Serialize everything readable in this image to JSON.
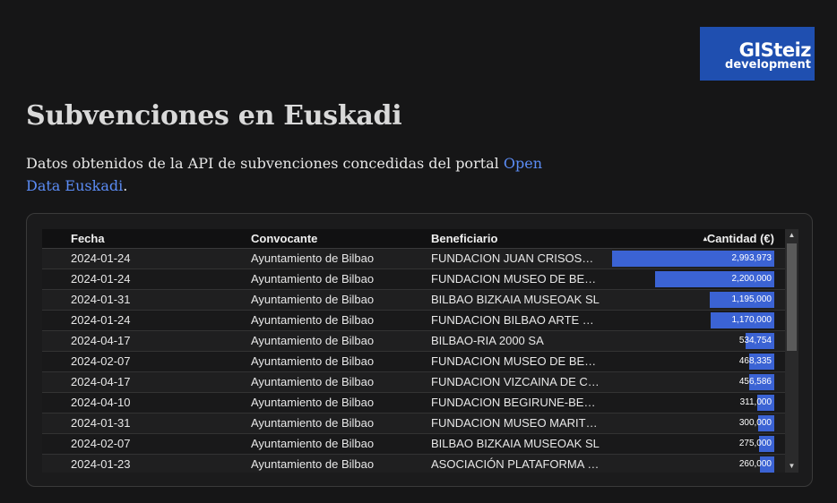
{
  "logo": {
    "line1": "GISteiz",
    "line2": "development"
  },
  "title": "Subvenciones en Euskadi",
  "description": {
    "text": "Datos obtenidos de la API de subvenciones concedidas del portal ",
    "link": "Open Data Euskadi",
    "end": "."
  },
  "table": {
    "columns": {
      "fecha": "Fecha",
      "convocante": "Convocante",
      "beneficiario": "Beneficiario",
      "cantidad": "Cantidad (€)"
    },
    "max_amount": 2993973,
    "rows": [
      {
        "fecha": "2024-01-24",
        "convocante": "Ayuntamiento de Bilbao",
        "beneficiario": "FUNDACION JUAN CRISOS…",
        "cantidad": "2,993,973",
        "amount": 2993973
      },
      {
        "fecha": "2024-01-24",
        "convocante": "Ayuntamiento de Bilbao",
        "beneficiario": "FUNDACION MUSEO DE BE…",
        "cantidad": "2,200,000",
        "amount": 2200000
      },
      {
        "fecha": "2024-01-31",
        "convocante": "Ayuntamiento de Bilbao",
        "beneficiario": "BILBAO BIZKAIA MUSEOAK SL",
        "cantidad": "1,195,000",
        "amount": 1195000
      },
      {
        "fecha": "2024-01-24",
        "convocante": "Ayuntamiento de Bilbao",
        "beneficiario": "FUNDACION BILBAO ARTE …",
        "cantidad": "1,170,000",
        "amount": 1170000
      },
      {
        "fecha": "2024-04-17",
        "convocante": "Ayuntamiento de Bilbao",
        "beneficiario": "BILBAO-RIA 2000 SA",
        "cantidad": "534,754",
        "amount": 534754
      },
      {
        "fecha": "2024-02-07",
        "convocante": "Ayuntamiento de Bilbao",
        "beneficiario": "FUNDACION MUSEO DE BE…",
        "cantidad": "468,335",
        "amount": 468335
      },
      {
        "fecha": "2024-04-17",
        "convocante": "Ayuntamiento de Bilbao",
        "beneficiario": "FUNDACION VIZCAINA DE C…",
        "cantidad": "456,586",
        "amount": 456586
      },
      {
        "fecha": "2024-04-10",
        "convocante": "Ayuntamiento de Bilbao",
        "beneficiario": "FUNDACION BEGIRUNE-BE…",
        "cantidad": "311,000",
        "amount": 311000
      },
      {
        "fecha": "2024-01-31",
        "convocante": "Ayuntamiento de Bilbao",
        "beneficiario": "FUNDACION MUSEO MARIT…",
        "cantidad": "300,000",
        "amount": 300000
      },
      {
        "fecha": "2024-02-07",
        "convocante": "Ayuntamiento de Bilbao",
        "beneficiario": "BILBAO BIZKAIA MUSEOAK SL",
        "cantidad": "275,000",
        "amount": 275000
      },
      {
        "fecha": "2024-01-23",
        "convocante": "Ayuntamiento de Bilbao",
        "beneficiario": "ASOCIACIÓN PLATAFORMA …",
        "cantidad": "260,000",
        "amount": 260000
      }
    ]
  },
  "colors": {
    "bar": "#3b63d4",
    "link": "#5b8cf5",
    "logo_bg": "#1f4fb0"
  },
  "icons": {
    "sort": "sort-indicator-icon",
    "scroll_up": "triangle-up-icon",
    "scroll_down": "triangle-down-icon"
  }
}
